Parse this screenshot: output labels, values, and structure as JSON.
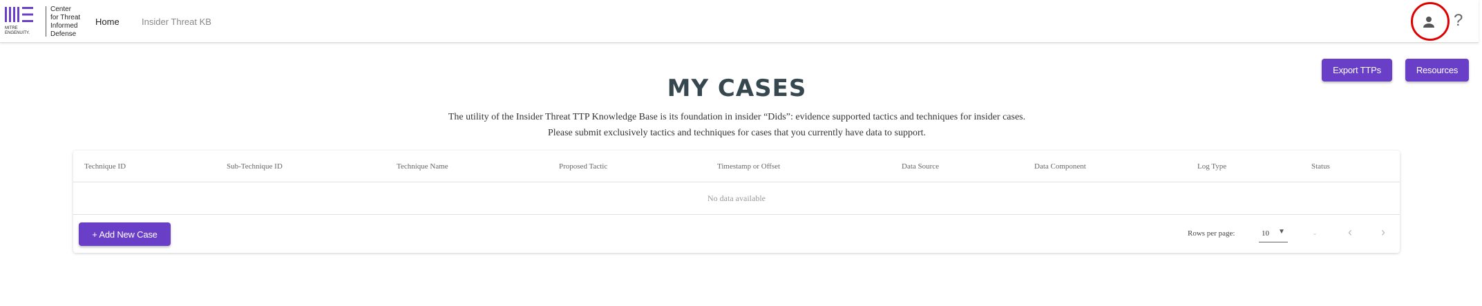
{
  "logo": {
    "brand_lines": [
      "MITRE",
      "ENGENUITY."
    ],
    "org_lines": [
      "Center",
      "for Threat",
      "Informed",
      "Defense"
    ]
  },
  "nav": {
    "home": "Home",
    "kb": "Insider Threat KB"
  },
  "header_icons": {
    "user": "user-icon",
    "help": "?"
  },
  "actions": {
    "export": "Export TTPs",
    "resources": "Resources"
  },
  "page": {
    "title": "MY CASES",
    "description_line1": "The utility of the Insider Threat TTP Knowledge Base is its foundation in insider “Dids”: evidence supported tactics and techniques for insider cases.",
    "description_line2": "Please submit exclusively tactics and techniques for cases that you currently have data to support."
  },
  "table": {
    "columns": [
      "Technique ID",
      "Sub-Technique ID",
      "Technique Name",
      "Proposed Tactic",
      "Timestamp or Offset",
      "Data Source",
      "Data Component",
      "Log Type",
      "Status"
    ],
    "empty_text": "No data available",
    "add_button": "+ Add New Case",
    "rows_per_page_label": "Rows per page:",
    "rows_per_page_value": "10",
    "range_text": "-",
    "prev": "‹",
    "next": "›"
  },
  "colors": {
    "accent": "#6a3fc8",
    "title": "#37474f",
    "highlight": "#e00000"
  }
}
